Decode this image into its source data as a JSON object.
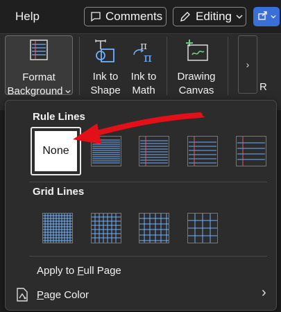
{
  "topbar": {
    "help_label": "Help",
    "comments_label": "Comments",
    "editing_label": "Editing"
  },
  "ribbon": {
    "format_background": {
      "line1": "Format",
      "line2": "Background"
    },
    "ink_to_shape": {
      "line1": "Ink to",
      "line2": "Shape"
    },
    "ink_to_math": {
      "line1": "Ink to",
      "line2": "Math"
    },
    "drawing_canvas": {
      "line1": "Drawing",
      "line2": "Canvas"
    },
    "more_glyph": "›",
    "cut_label": "R"
  },
  "panel": {
    "rule_lines_heading": "Rule Lines",
    "none_label": "None",
    "grid_lines_heading": "Grid Lines",
    "apply_full_page": {
      "pre": "Apply to ",
      "accel": "F",
      "post": "ull Page"
    },
    "page_color": {
      "accel": "P",
      "post": "age Color",
      "chevron": "›"
    }
  },
  "colors": {
    "line_blue": "#6fb1ff",
    "margin_red": "#e05a6a",
    "arrow_red": "#e3101a",
    "share_blue": "#3b6fd8"
  }
}
